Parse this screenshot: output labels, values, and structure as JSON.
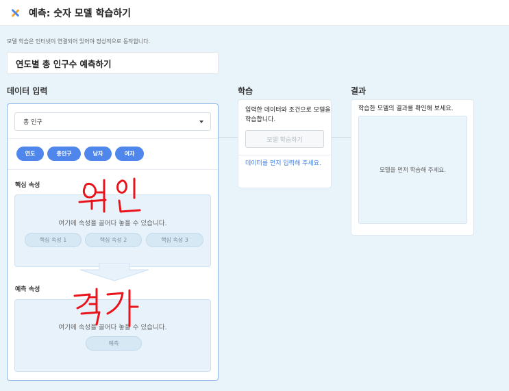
{
  "window": {
    "title": "예측: 숫자 모델 학습하기"
  },
  "notice": "모델 학습은 인터넷이 연결되어 있어야 정상적으로 동작합니다.",
  "project_name": "연도별 총 인구수 예측하기",
  "sections": {
    "data_input": "데이터 입력",
    "learn": "학습",
    "result": "결과"
  },
  "data_input": {
    "selected_table": "총 인구",
    "attributes": [
      "연도",
      "총인구",
      "남자",
      "여자"
    ],
    "core_attributes": {
      "label": "핵심 속성",
      "hint": "여기에 속성을 끌어다 놓을 수 있습니다.",
      "slots": [
        "핵심 속성 1",
        "핵심 속성 2",
        "핵심 속성 3"
      ]
    },
    "prediction_attribute": {
      "label": "예측 속성",
      "hint": "여기에 속성을 끌어다 놓을 수 있습니다.",
      "slots": [
        "예측"
      ]
    }
  },
  "learn": {
    "description": "입력한 데이터와 조건으로 모델을 학습합니다.",
    "button_label": "모델 학습하기",
    "warning": "데이터를 먼저 입력해 주세요."
  },
  "result": {
    "description": "학습한 모델의 결과를 확인해 보세요.",
    "placeholder": "모델을 먼저 학습해 주세요."
  },
  "handwritten_annotations": [
    "원인",
    "결과"
  ],
  "colors": {
    "accent": "#4f86ec",
    "link": "#3d7ee8",
    "background": "#e8f4fa",
    "annotation_ink": "#e8131b"
  },
  "icons": {
    "close": "close-icon",
    "dropdown": "chevron-down-icon"
  }
}
